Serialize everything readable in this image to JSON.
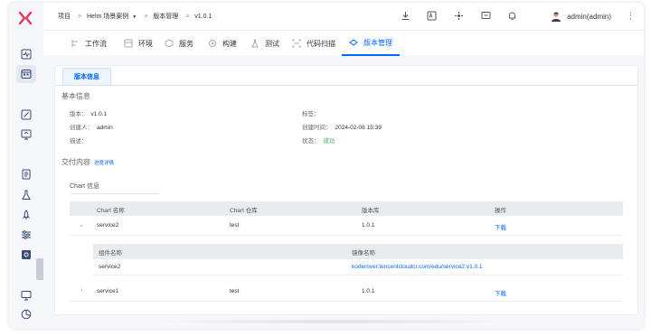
{
  "colors": {
    "accent": "#0066ff",
    "success": "#3fb16b",
    "logo": "#e8355a"
  },
  "topbar": {
    "breadcrumb": {
      "item1": "项目",
      "item2": "Helm 场景案例",
      "item3": "版本管理",
      "item4": "v1.0.1"
    },
    "user_label": "admin(admin)"
  },
  "nav": {
    "tabs": [
      "工作流",
      "环境",
      "服务",
      "构建",
      "测试",
      "代码扫描",
      "版本管理"
    ]
  },
  "main": {
    "subtab_label": "版本信息",
    "basic_title": "基本信息",
    "version_label": "版本：",
    "version_value": "v1.0.1",
    "tag_label": "标签：",
    "creator_label": "创建人：",
    "creator_value": "admin",
    "created_time_label": "创建时间：",
    "created_time_value": "2024-02-08 15:39",
    "desc_label": "描述：",
    "status_label": "状态：",
    "status_value": "成功",
    "delivery_title": "交付内容",
    "progress_link": "进度详情",
    "chart_info_title": "Chart 信息"
  },
  "table": {
    "headers": {
      "name": "Chart 名称",
      "repo": "Chart 仓库",
      "version": "版本库",
      "ops": "操作"
    },
    "rows": [
      {
        "name": "service2",
        "repo": "test",
        "version": "1.0.1",
        "action": "下载"
      },
      {
        "name": "service1",
        "repo": "test",
        "version": "1.0.1",
        "action": "下载"
      }
    ],
    "sub_headers": {
      "component": "组件名称",
      "image": "镜像名称"
    },
    "sub_rows": [
      {
        "component": "service2",
        "image": "koderover.tencentcloudcr.com/edu/service2:v1.0.1"
      }
    ]
  }
}
